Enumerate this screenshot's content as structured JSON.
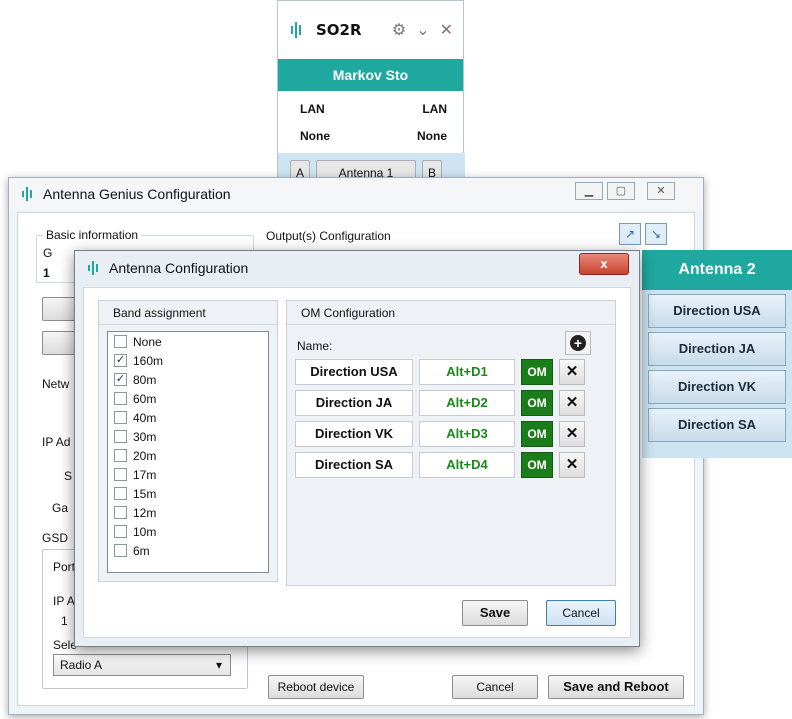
{
  "so2r": {
    "title": "SO2R",
    "station": "Markov Sto",
    "row1_left": "LAN",
    "row1_right": "LAN",
    "row2_left": "None",
    "row2_right": "None",
    "port_a": "A",
    "antenna": "Antenna 1",
    "port_b": "B"
  },
  "main_window": {
    "title": "Antenna Genius Configuration",
    "basic_info_label": "Basic information",
    "basic_g": "G",
    "basic_value": "1",
    "outputs_label": "Output(s) Configuration",
    "net_label": "Netw",
    "ip_label": "IP Ad",
    "s_label": "S",
    "ga_label": "Ga",
    "gsd_label": "GSD",
    "port_label": "Port",
    "ip2_label": "IP A",
    "val_1": "1",
    "sel_label": "Sele",
    "radio_select": "Radio A",
    "reboot_button": "Reboot device",
    "cancel_button": "Cancel",
    "save_reboot_button": "Save and Reboot"
  },
  "side_panel": {
    "title": "Antenna 2",
    "items": [
      "Direction USA",
      "Direction JA",
      "Direction VK",
      "Direction SA"
    ]
  },
  "dialog": {
    "title": "Antenna Configuration",
    "close_glyph": "x",
    "band_header": "Band assignment",
    "bands": [
      {
        "label": "None",
        "checked": false
      },
      {
        "label": "160m",
        "checked": true
      },
      {
        "label": "80m",
        "checked": true
      },
      {
        "label": "60m",
        "checked": false
      },
      {
        "label": "40m",
        "checked": false
      },
      {
        "label": "30m",
        "checked": false
      },
      {
        "label": "20m",
        "checked": false
      },
      {
        "label": "17m",
        "checked": false
      },
      {
        "label": "15m",
        "checked": false
      },
      {
        "label": "12m",
        "checked": false
      },
      {
        "label": "10m",
        "checked": false
      },
      {
        "label": "6m",
        "checked": false
      }
    ],
    "om_header": "OM Configuration",
    "name_label": "Name:",
    "om_rows": [
      {
        "name": "Direction USA",
        "key": "Alt+D1",
        "tag": "OM"
      },
      {
        "name": "Direction JA",
        "key": "Alt+D2",
        "tag": "OM"
      },
      {
        "name": "Direction VK",
        "key": "Alt+D3",
        "tag": "OM"
      },
      {
        "name": "Direction SA",
        "key": "Alt+D4",
        "tag": "OM"
      }
    ],
    "save_button": "Save",
    "cancel_button": "Cancel"
  },
  "colors": {
    "accent": "#1fa8a0",
    "om_green": "#1a7d1a",
    "key_green": "#1a8a1a"
  }
}
